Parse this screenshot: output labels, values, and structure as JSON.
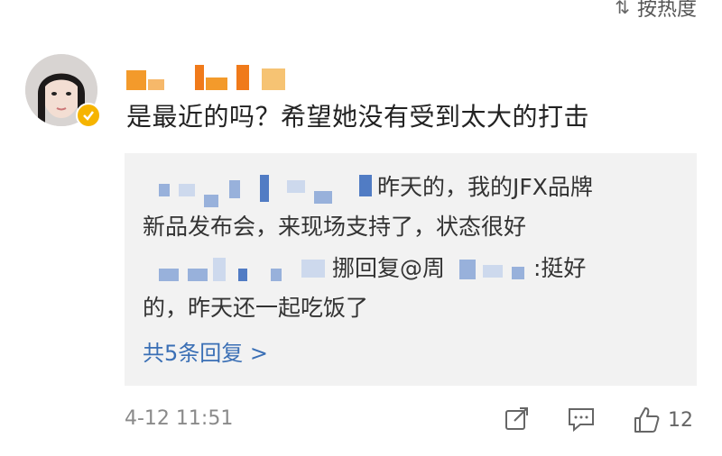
{
  "sort": {
    "label": "按热度",
    "icon": "sort-icon"
  },
  "comment": {
    "text": "是最近的吗？希望她没有受到太大的打击",
    "timestamp": "4-12 11:51",
    "like_count": "12"
  },
  "replies": [
    {
      "text_line1": "昨天的，我的JFX品牌",
      "text_line2": "新品发布会，来现场支持了，状态很好"
    },
    {
      "pre": "挪回复@周",
      "text_line1": ":挺好",
      "text_line2": "的，昨天还一起吃饭了"
    }
  ],
  "more_replies": "共5条回复 >",
  "colors": {
    "link": "#3a6fb5",
    "reply_bg": "#f2f2f2",
    "verified": "#f6b400",
    "username_mask": "#f39a2b"
  }
}
